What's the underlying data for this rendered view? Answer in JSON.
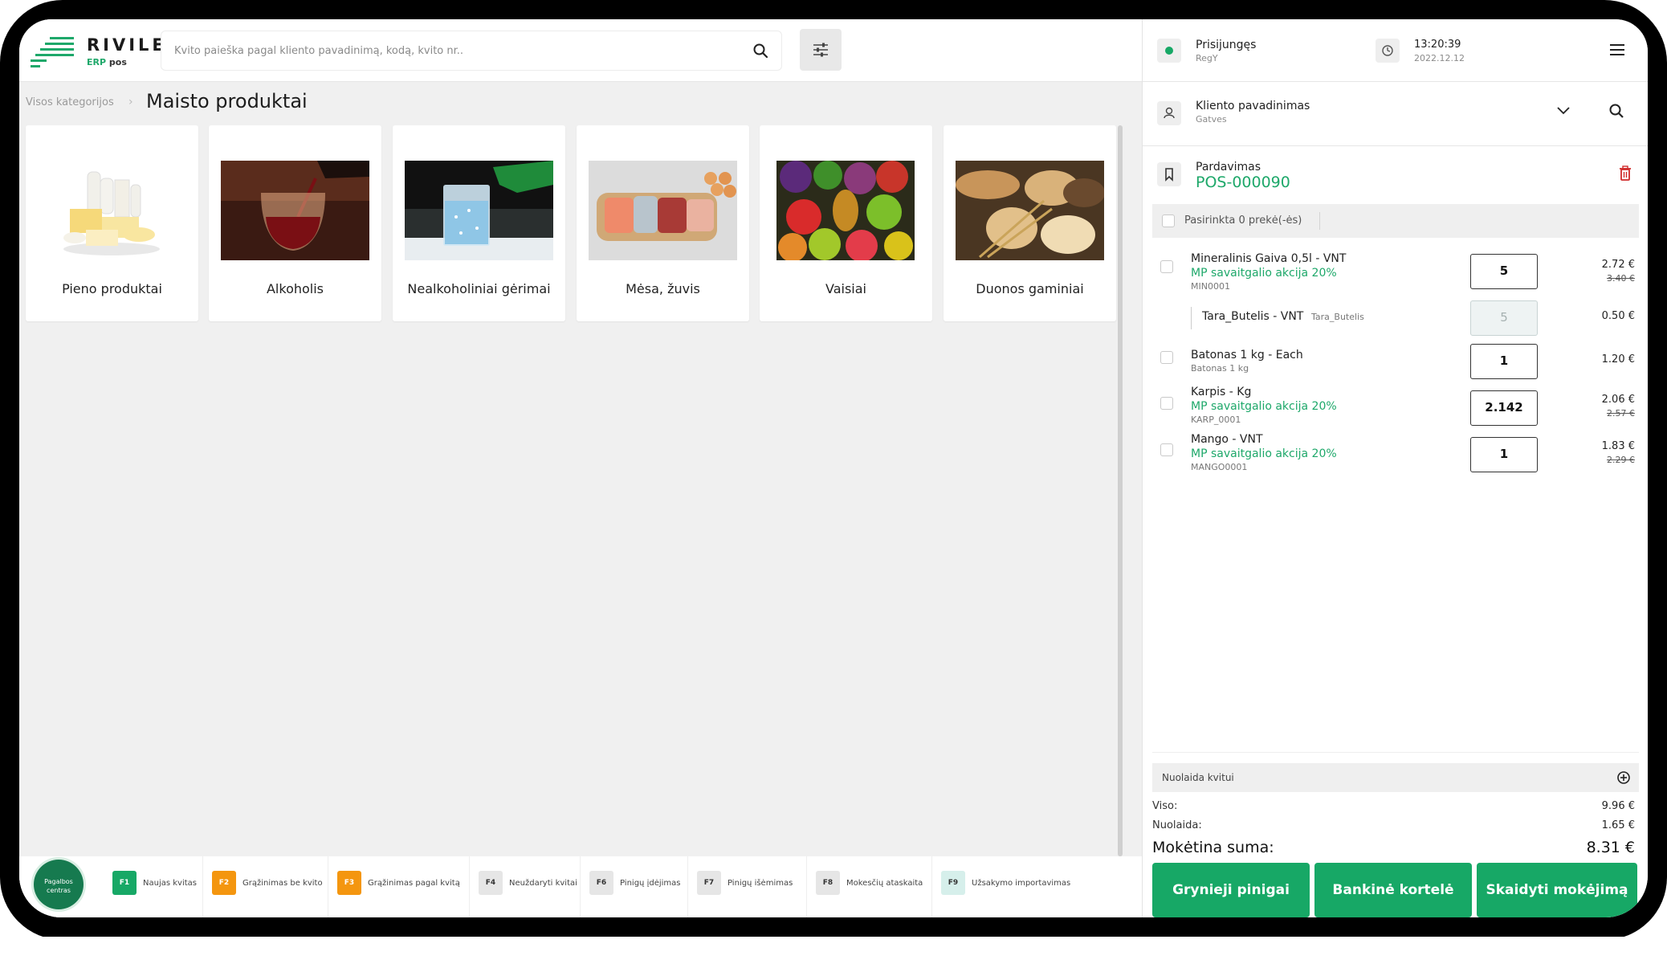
{
  "app": {
    "logo_name": "RIVILE",
    "logo_sub_erp": "ERP",
    "logo_sub_pos": "pos"
  },
  "search": {
    "placeholder": "Kvito paieška pagal kliento pavadinimą, kodą, kvito nr..",
    "search_icon": "search-icon",
    "filter_icon": "sliders-icon"
  },
  "breadcrumb": {
    "root": "Visos kategorijos",
    "separator": "›",
    "current": "Maisto produktai"
  },
  "categories": [
    {
      "label": "Pieno produktai",
      "image": "dairy-products"
    },
    {
      "label": "Alkoholis",
      "image": "wine-glass"
    },
    {
      "label": "Nealkoholiniai gėrimai",
      "image": "water-glass"
    },
    {
      "label": "Mėsa, žuvis",
      "image": "meat-fish-board"
    },
    {
      "label": "Vaisiai",
      "image": "fruits"
    },
    {
      "label": "Duonos gaminiai",
      "image": "bread"
    }
  ],
  "help": {
    "label_line1": "Pagalbos",
    "label_line2": "centras"
  },
  "function_keys": [
    {
      "key": "F1",
      "label": "Naujas kvitas",
      "color": "#17a866"
    },
    {
      "key": "F2",
      "label": "Grąžinimas be kvito",
      "color": "#f4960f"
    },
    {
      "key": "F3",
      "label": "Grąžinimas pagal kvitą",
      "color": "#f4960f"
    },
    {
      "key": "F4",
      "label": "Neuždaryti kvitai",
      "color": "#e6e6e6"
    },
    {
      "key": "F6",
      "label": "Pinigų įdėjimas",
      "color": "#e6e6e6"
    },
    {
      "key": "F7",
      "label": "Pinigų išėmimas",
      "color": "#e6e6e6"
    },
    {
      "key": "F8",
      "label": "Mokesčių ataskaita",
      "color": "#e6e6e6"
    },
    {
      "key": "F9",
      "label": "Užsakymo importavimas",
      "color": "#d6efeb"
    }
  ],
  "status": {
    "login_title": "Prisijungęs",
    "login_user": "RegY",
    "time": "13:20:39",
    "date": "2022.12.12",
    "online_color": "#17a866"
  },
  "client": {
    "title": "Kliento pavadinimas",
    "subtitle": "Gatves"
  },
  "sale": {
    "title": "Pardavimas",
    "number": "POS-000090"
  },
  "selection": {
    "label": "Pasirinkta 0 prekė(-ės)"
  },
  "cart": [
    {
      "name": "Mineralinis Gaiva 0,5l - VNT",
      "promo": "MP savaitgalio akcija 20%",
      "code": "MIN0001",
      "qty": "5",
      "price": "2.72 €",
      "old_price": "3.40 €"
    },
    {
      "name": "Tara_Butelis - VNT",
      "promo": "",
      "code": "Tara_Butelis",
      "qty": "5",
      "price": "0.50 €",
      "old_price": "",
      "sub": true
    },
    {
      "name": "Batonas 1 kg - Each",
      "promo": "",
      "code": "Batonas 1 kg",
      "qty": "1",
      "price": "1.20 €",
      "old_price": ""
    },
    {
      "name": "Karpis - Kg",
      "promo": "MP savaitgalio akcija 20%",
      "code": "KARP_0001",
      "qty": "2.142",
      "price": "2.06 €",
      "old_price": "2.57 €"
    },
    {
      "name": "Mango - VNT",
      "promo": "MP savaitgalio akcija 20%",
      "code": "MANGO0001",
      "qty": "1",
      "price": "1.83 €",
      "old_price": "2.29 €"
    }
  ],
  "discount": {
    "label": "Nuolaida kvitui"
  },
  "totals": {
    "total_label": "Viso:",
    "total_value": "9.96 €",
    "discount_label": "Nuolaida:",
    "discount_value": "1.65 €",
    "pay_label": "Mokėtina suma:",
    "pay_value": "8.31 €"
  },
  "payment": {
    "cash": "Grynieji pinigai",
    "card": "Bankinė kortelė",
    "split": "Skaidyti mokėjimą"
  }
}
